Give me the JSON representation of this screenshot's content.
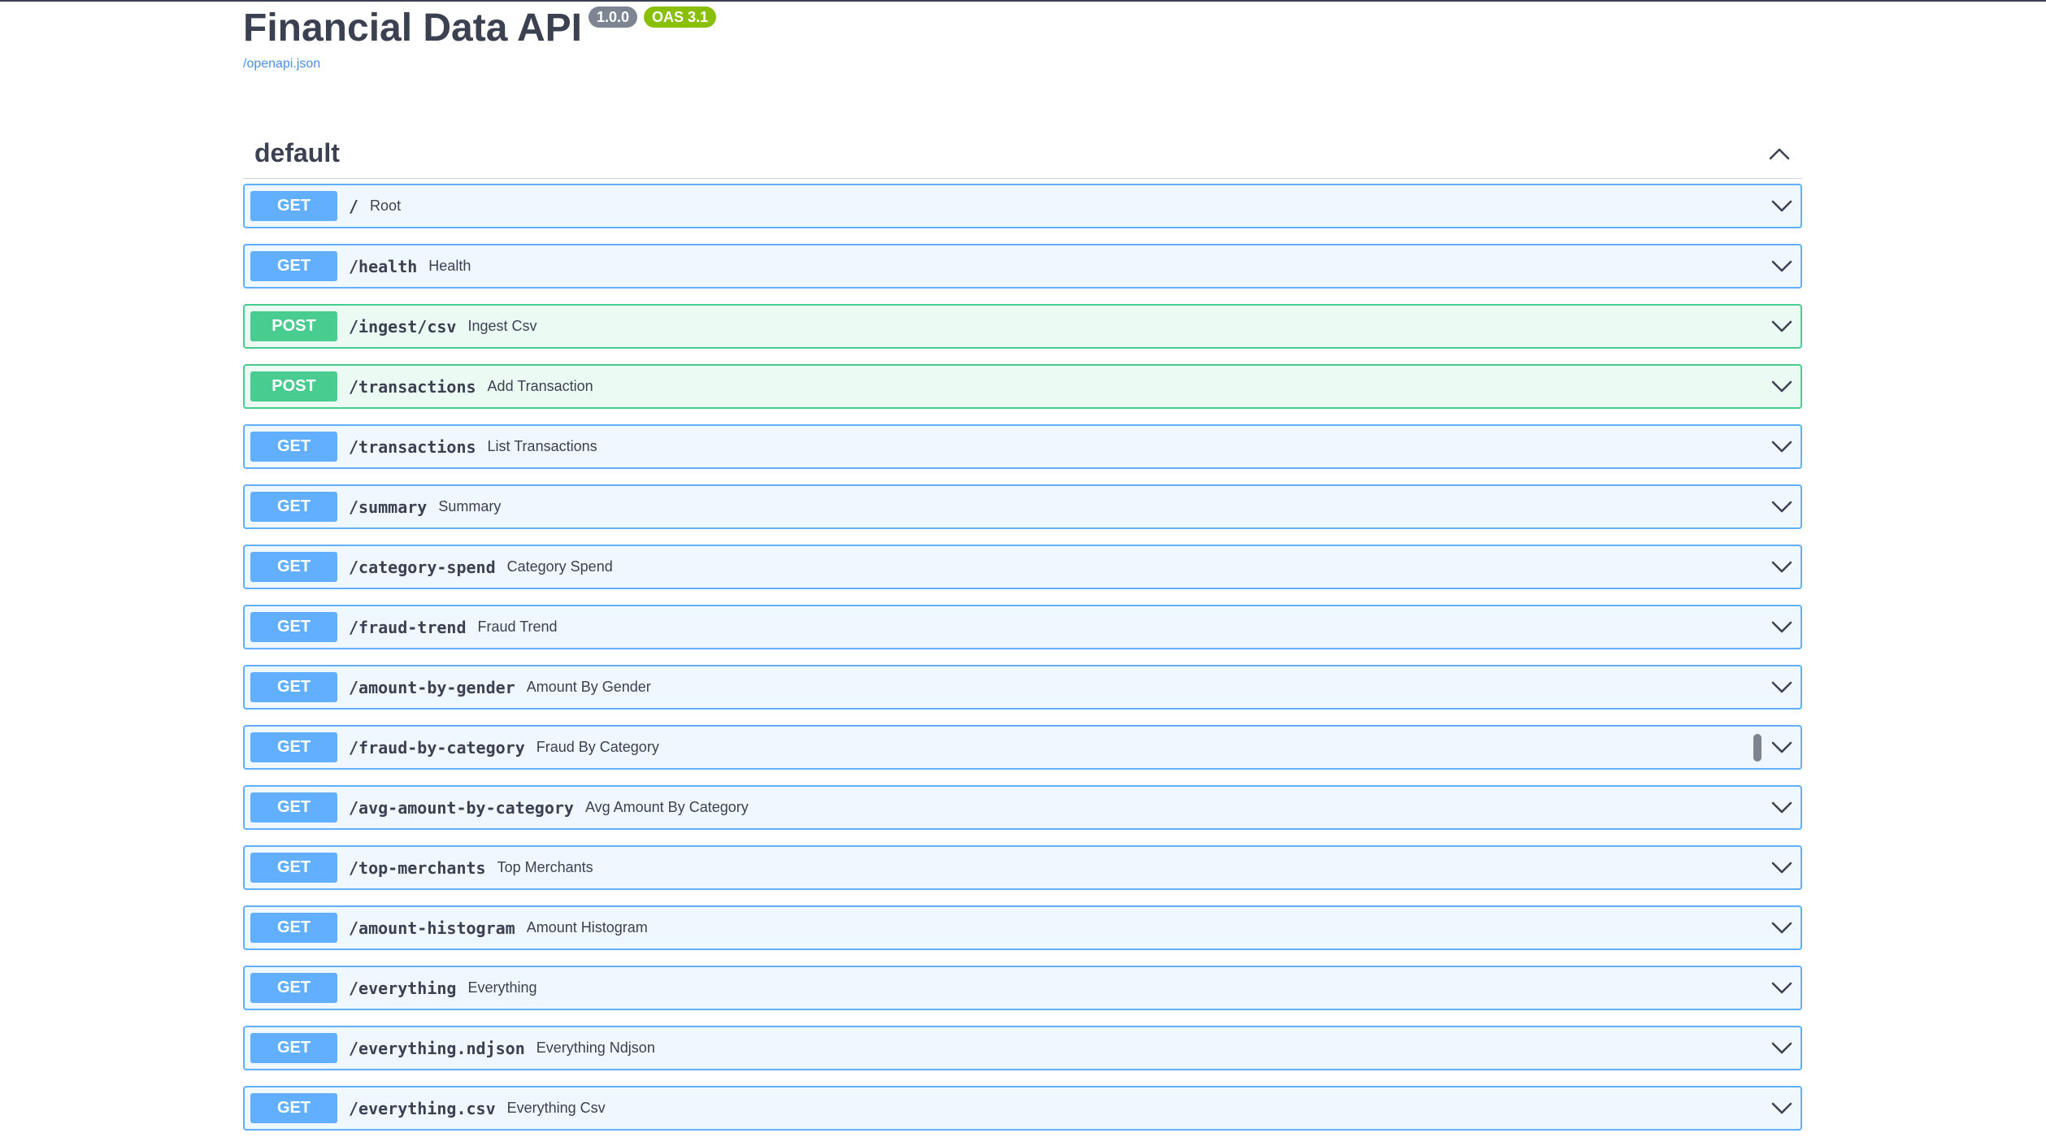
{
  "info": {
    "title": "Financial Data API",
    "version_badge": "1.0.0",
    "oas_badge": "OAS 3.1",
    "spec_link": "/openapi.json"
  },
  "section": {
    "tag": "default",
    "tag_arrow_icon": "chevron-up-icon"
  },
  "colors": {
    "get": "#61affe",
    "post": "#49cc90",
    "text": "#3b4151",
    "link": "#4990e2",
    "version_badge": "#7d8492",
    "oas_badge": "#89bf04"
  },
  "operations": [
    {
      "method": "GET",
      "path": "/",
      "summary": "Root"
    },
    {
      "method": "GET",
      "path": "/health",
      "summary": "Health"
    },
    {
      "method": "POST",
      "path": "/ingest/csv",
      "summary": "Ingest Csv"
    },
    {
      "method": "POST",
      "path": "/transactions",
      "summary": "Add Transaction"
    },
    {
      "method": "GET",
      "path": "/transactions",
      "summary": "List Transactions"
    },
    {
      "method": "GET",
      "path": "/summary",
      "summary": "Summary"
    },
    {
      "method": "GET",
      "path": "/category-spend",
      "summary": "Category Spend"
    },
    {
      "method": "GET",
      "path": "/fraud-trend",
      "summary": "Fraud Trend"
    },
    {
      "method": "GET",
      "path": "/amount-by-gender",
      "summary": "Amount By Gender"
    },
    {
      "method": "GET",
      "path": "/fraud-by-category",
      "summary": "Fraud By Category"
    },
    {
      "method": "GET",
      "path": "/avg-amount-by-category",
      "summary": "Avg Amount By Category"
    },
    {
      "method": "GET",
      "path": "/top-merchants",
      "summary": "Top Merchants"
    },
    {
      "method": "GET",
      "path": "/amount-histogram",
      "summary": "Amount Histogram"
    },
    {
      "method": "GET",
      "path": "/everything",
      "summary": "Everything"
    },
    {
      "method": "GET",
      "path": "/everything.ndjson",
      "summary": "Everything Ndjson"
    },
    {
      "method": "GET",
      "path": "/everything.csv",
      "summary": "Everything Csv"
    }
  ]
}
